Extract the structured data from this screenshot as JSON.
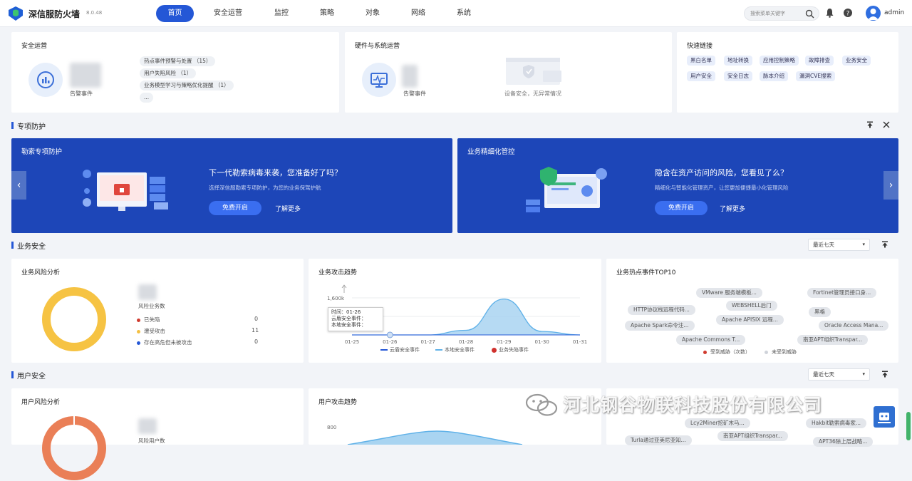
{
  "header": {
    "brand": "深信服防火墙",
    "version": "8.0.48",
    "nav": [
      "首页",
      "安全运营",
      "监控",
      "策略",
      "对象",
      "网络",
      "系统"
    ],
    "active_nav": "首页",
    "search_placeholder": "搜索菜单关键字",
    "user": "admin"
  },
  "top_cards": {
    "security_ops": {
      "title": "安全运营",
      "metric_label": "告警事件",
      "items": [
        "热点事件预警与处置 （15）",
        "用户失陷风险 （1）",
        "业务模型学习与策略优化提醒 （1）",
        "..."
      ]
    },
    "hardware_ops": {
      "title": "硬件与系统运营",
      "metric_label": "告警事件",
      "status": "设备安全，无异常情况"
    },
    "quick_links": {
      "title": "快速链接",
      "links": [
        "黑白名单",
        "地址转换",
        "应用控制策略",
        "故障排查",
        "业务安全",
        "用户安全",
        "安全日志",
        "脉本介绍",
        "漏洞CVE搜索"
      ]
    }
  },
  "special_protection": {
    "title": "专项防护",
    "banners": [
      {
        "title": "勒索专项防护",
        "headline": "下一代勒索病毒来袭，您准备好了吗？",
        "desc": "选择深信服勒索专项防护，为您的业务保驾护航",
        "primary": "免费开启",
        "secondary": "了解更多"
      },
      {
        "title": "业务精细化管控",
        "headline": "隐含在资产访问的风险，您看见了么？",
        "desc": "精细化与智能化管理资产，让您更加便捷最小化管理风险",
        "primary": "免费开启",
        "secondary": "了解更多"
      }
    ]
  },
  "business_security": {
    "title": "业务安全",
    "range": "最近七天",
    "risk": {
      "title": "业务风险分析",
      "metric_label": "风险业务数",
      "rows": [
        {
          "label": "已失陷",
          "value": "0",
          "color": "#d03b2f"
        },
        {
          "label": "遭受攻击",
          "value": "11",
          "color": "#f4c043"
        },
        {
          "label": "存在高危但未被攻击",
          "value": "0",
          "color": "#2457d6"
        }
      ]
    },
    "trend": {
      "title": "业务攻击趋势",
      "tooltip": [
        "时间：01-26",
        "云盾安全事件：",
        "本地安全事件："
      ],
      "legend": [
        "云盾安全事件",
        "本地安全事件",
        "业务失陷事件"
      ]
    },
    "hot": {
      "title": "业务热点事件TOP10",
      "tags": [
        "VMware 服务端模板...",
        "Fortinet管理员接口身...",
        "HTTP协议栈远程代码...",
        "WEBSHELL后门",
        "黑格",
        "Apache Spark命令注...",
        "Apache APISIX 远程...",
        "Oracle Access Mana...",
        "Apache Commons T...",
        "南亚APT组织Transpar..."
      ],
      "legend": [
        "受到威胁（次数）",
        "未受到威胁"
      ]
    }
  },
  "user_security": {
    "title": "用户安全",
    "range": "最近七天",
    "risk": {
      "title": "用户风险分析",
      "metric_label": "风险用户数"
    },
    "trend": {
      "title": "用户攻击趋势"
    },
    "hot": {
      "tags": [
        "Lcy2Miner挖矿木马...",
        "Hakbit勒索病毒家...",
        "Turla通过亚美尼亚知...",
        "南亚APT组织Transpar...",
        "APT36除上层战略..."
      ]
    }
  },
  "watermark": "河北钢谷物联科技股份有限公司",
  "colors": {
    "primary": "#2457d6",
    "banner": "#1d46b8",
    "donut_business": "#f6c343",
    "donut_user": "#ea7f57",
    "chart_fill": "#a9d4f1"
  },
  "chart_data": [
    {
      "type": "area",
      "title": "业务攻击趋势",
      "x": [
        "01-25",
        "01-26",
        "01-27",
        "01-28",
        "01-29",
        "01-30",
        "01-31"
      ],
      "ylim": [
        0,
        1600000
      ],
      "yticks": [
        "1,600k"
      ],
      "series": [
        {
          "name": "云盾安全事件",
          "values": [
            0,
            0,
            0,
            0,
            0,
            0,
            0
          ]
        },
        {
          "name": "本地安全事件",
          "values": [
            0,
            0,
            0,
            200000,
            1550000,
            150000,
            0
          ]
        },
        {
          "name": "业务失陷事件",
          "values": [
            0,
            0,
            0,
            0,
            0,
            0,
            0
          ]
        }
      ]
    },
    {
      "type": "pie",
      "title": "业务风险分析",
      "labels": [
        "已失陷",
        "遭受攻击",
        "存在高危但未被攻击"
      ],
      "values": [
        0,
        11,
        0
      ]
    }
  ]
}
